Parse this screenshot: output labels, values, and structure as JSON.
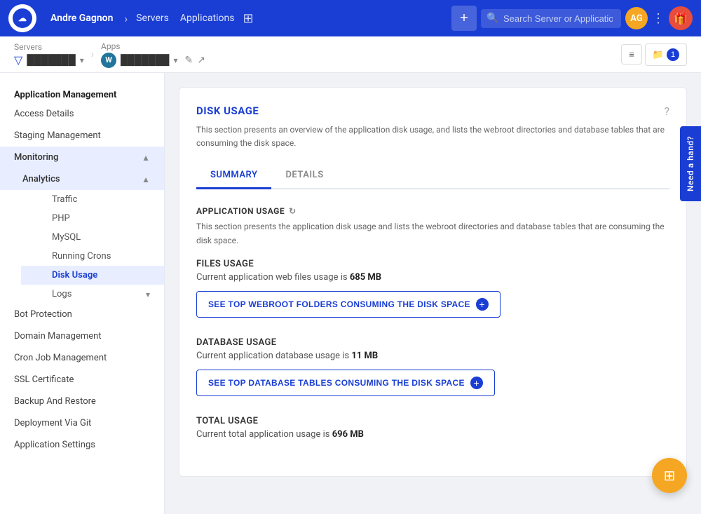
{
  "topnav": {
    "user_name": "Andre Gagnon",
    "servers_link": "Servers",
    "applications_link": "Applications",
    "grid_icon": "⊞",
    "plus_label": "+",
    "search_placeholder": "Search Server or Application",
    "avatar_initials": "AG",
    "more_icon": "⋮",
    "gift_icon": "🎁",
    "add_icon": "+"
  },
  "breadcrumb": {
    "servers_label": "Servers",
    "server_name": "███████",
    "apps_label": "Apps",
    "app_name": "███████",
    "view_icon": "≡",
    "folder_icon": "📁",
    "badge_count": "1",
    "edit_icon": "✎",
    "external_icon": "↗"
  },
  "sidebar": {
    "heading": "Application Management",
    "items": [
      {
        "label": "Access Details",
        "active": false,
        "has_children": false
      },
      {
        "label": "Staging Management",
        "active": false,
        "has_children": false
      },
      {
        "label": "Monitoring",
        "active": false,
        "has_children": true,
        "expanded": true
      },
      {
        "label": "Analytics",
        "active": true,
        "has_children": true,
        "expanded": true,
        "is_sub": false
      },
      {
        "label": "Traffic",
        "is_sub": true,
        "active": false
      },
      {
        "label": "PHP",
        "is_sub": true,
        "active": false
      },
      {
        "label": "MySQL",
        "is_sub": true,
        "active": false
      },
      {
        "label": "Running Crons",
        "is_sub": true,
        "active": false
      },
      {
        "label": "Disk Usage",
        "is_sub": true,
        "active": true
      },
      {
        "label": "Logs",
        "is_sub": true,
        "active": false,
        "has_children": true
      },
      {
        "label": "Bot Protection",
        "active": false,
        "has_children": false
      },
      {
        "label": "Domain Management",
        "active": false,
        "has_children": false
      },
      {
        "label": "Cron Job Management",
        "active": false,
        "has_children": false
      },
      {
        "label": "SSL Certificate",
        "active": false,
        "has_children": false
      },
      {
        "label": "Backup And Restore",
        "active": false,
        "has_children": false
      },
      {
        "label": "Deployment Via Git",
        "active": false,
        "has_children": false
      },
      {
        "label": "Application Settings",
        "active": false,
        "has_children": false
      }
    ]
  },
  "content": {
    "page_title": "DISK USAGE",
    "page_description": "This section presents an overview of the application disk usage, and lists the webroot directories and database tables that are consuming the disk space.",
    "tabs": [
      {
        "label": "SUMMARY",
        "active": true
      },
      {
        "label": "DETAILS",
        "active": false
      }
    ],
    "section_title": "APPLICATION USAGE",
    "section_desc": "This section presents the application disk usage and lists the webroot directories and database tables that are consuming the disk space.",
    "files_usage": {
      "label": "FILES USAGE",
      "description_prefix": "Current application web files usage is ",
      "value": "685 MB",
      "button_label": "See Top Webroot Folders Consuming The Disk Space"
    },
    "database_usage": {
      "label": "DATABASE USAGE",
      "description_prefix": "Current application database usage is ",
      "value": "11 MB",
      "button_label": "See Top Database Tables Consuming The Disk Space"
    },
    "total_usage": {
      "label": "TOTAL USAGE",
      "description_prefix": "Current total application usage is ",
      "value": "696 MB"
    }
  },
  "help_sidebar": {
    "label": "Need a hand?"
  },
  "fab": {
    "icon": "⊞"
  }
}
